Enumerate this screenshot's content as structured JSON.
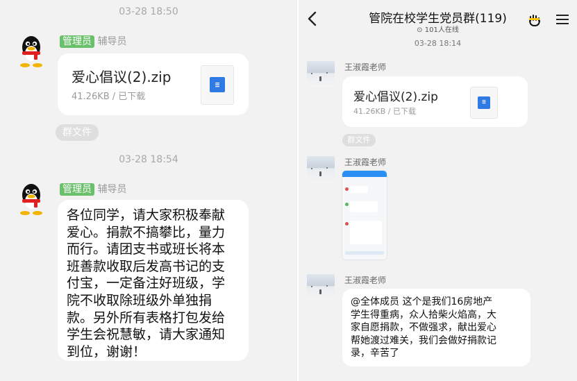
{
  "left": {
    "messages": [
      {
        "time": "03-28 18:50",
        "badge": "管理员",
        "role": "辅导员",
        "file_name": "爱心倡议(2).zip",
        "file_meta": "41.26KB / 已下载",
        "group_file": "群文件"
      },
      {
        "time": "03-28 18:54",
        "badge": "管理员",
        "role": "辅导员",
        "text_lines": [
          "各位同学，请大家积极奉献",
          "爱心。捐款不搞攀比，量力",
          "而行。请团支书或班长将本",
          "班善款收取后发高书记的支",
          "付宝，一定备注好班级，学",
          "院不收取除班级外单独捐",
          "款。另外所有表格打包发给",
          "学生会祝慧敏，请大家通知",
          "到位，谢谢！"
        ]
      }
    ]
  },
  "right": {
    "header": {
      "back_icon": "chevron-left-icon",
      "title": "管院在校学生党员群(119)",
      "online": "101人在线",
      "hand_icon": "hand-icon",
      "menu_icon": "menu-icon"
    },
    "time": "03-28 18:14",
    "messages": [
      {
        "sender": "王淑霞老师",
        "file_name": "爱心倡议(2).zip",
        "file_meta": "41.26KB / 已下载",
        "group_file": "群文件"
      },
      {
        "sender": "王淑霞老师",
        "image": "chat-screenshot"
      },
      {
        "sender": "王淑霞老师",
        "text_lines": [
          "@全体成员 这个是我们16房地产",
          "学生得重病，众人拾柴火焰高，大",
          "家自愿捐款，不做强求，献出爱心",
          "帮她渡过难关，我们会做好捐款记",
          "录，辛苦了"
        ]
      }
    ]
  }
}
